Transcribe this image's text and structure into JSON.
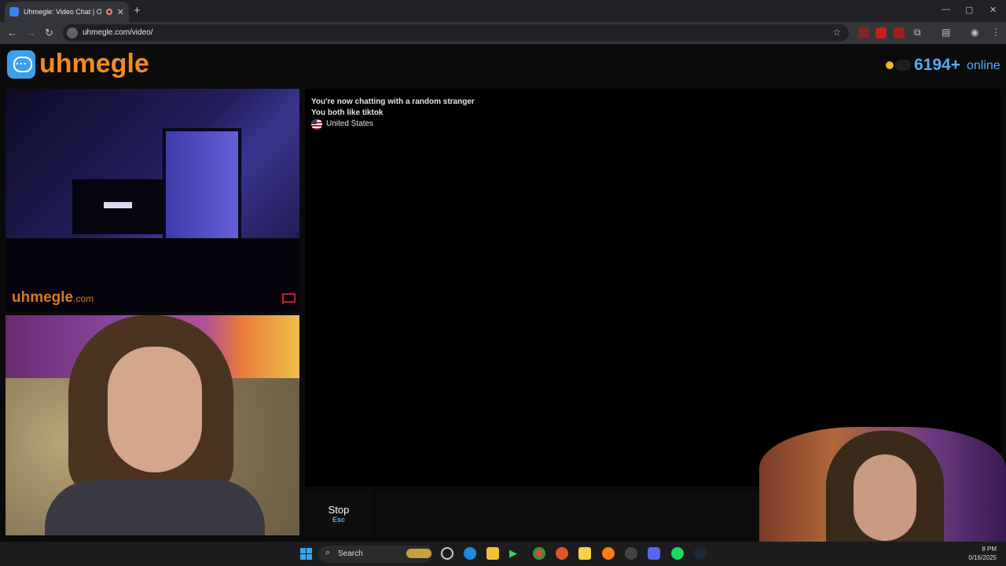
{
  "browser": {
    "tab_title": "Uhmegle: Video Chat | Ome",
    "url": "uhmegle.com/video/",
    "new_tab_label": "+",
    "close_tab_label": "✕",
    "minimize_label": "—",
    "restore_label": "▢",
    "close_window_label": "✕"
  },
  "site": {
    "logo_text": "uhmegle",
    "online_count": "6194+",
    "online_label": "online"
  },
  "stranger_video": {
    "watermark": "uhmegle",
    "watermark_suffix": ".com"
  },
  "chat": {
    "line1": "You're now chatting with a random stranger",
    "line2": "You both like tiktok",
    "country": "United States"
  },
  "controls": {
    "stop_label": "Stop",
    "stop_key": "Esc"
  },
  "taskbar": {
    "search_label": "Search",
    "time_partial": "8 PM",
    "date_partial": "0/16/2025"
  },
  "colors": {
    "brand_orange": "#f08a24",
    "accent_blue": "#5aaaf5",
    "report_red": "#c0202a"
  }
}
